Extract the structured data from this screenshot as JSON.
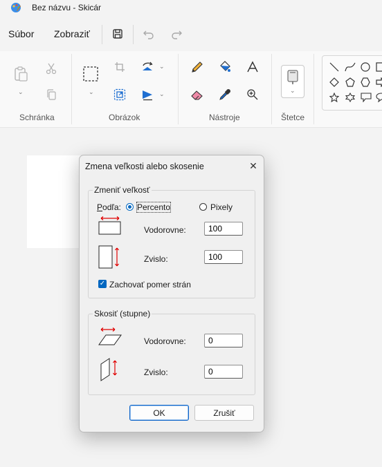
{
  "window": {
    "title": "Bez názvu - Skicár",
    "app_icon": "paint-palette-icon"
  },
  "menu": {
    "file": "Súbor",
    "view": "Zobraziť"
  },
  "toolbar": {
    "save_icon": "save-icon",
    "undo_icon": "undo-icon",
    "redo_icon": "redo-icon"
  },
  "ribbon": {
    "groups": {
      "clipboard": "Schránka",
      "image": "Obrázok",
      "tools": "Nástroje",
      "brushes": "Štetce"
    }
  },
  "dialog": {
    "title": "Zmena veľkosti alebo skosenie",
    "resize": {
      "legend": "Zmeniť veľkosť",
      "by_label": "Podľa:",
      "percent_label": "Percento",
      "pixels_label": "Pixely",
      "selected": "Percento",
      "horizontal_label": "Vodorovne:",
      "horizontal_value": "100",
      "vertical_label": "Zvislo:",
      "vertical_value": "100",
      "keep_ratio_label": "Zachovať pomer strán",
      "keep_ratio_checked": true
    },
    "skew": {
      "legend": "Skosiť (stupne)",
      "horizontal_label": "Vodorovne:",
      "horizontal_value": "0",
      "vertical_label": "Zvislo:",
      "vertical_value": "0"
    },
    "ok_label": "OK",
    "cancel_label": "Zrušiť"
  },
  "colors": {
    "accent": "#0067c0",
    "arrow": "#e00000",
    "blue_tool": "#1f6fd1"
  }
}
